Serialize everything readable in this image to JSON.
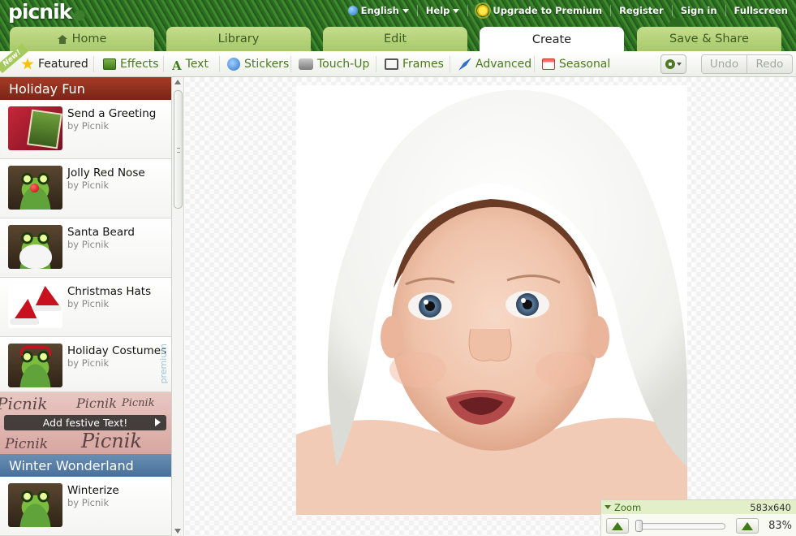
{
  "app": {
    "logo": "picnik"
  },
  "toplinks": {
    "language": "English",
    "help": "Help",
    "upgrade": "Upgrade to Premium",
    "register": "Register",
    "signin": "Sign in",
    "fullscreen": "Fullscreen"
  },
  "tabs": [
    {
      "label": "Home"
    },
    {
      "label": "Library"
    },
    {
      "label": "Edit"
    },
    {
      "label": "Create"
    },
    {
      "label": "Save & Share"
    }
  ],
  "toolbar": {
    "new_badge": "New!",
    "items": [
      {
        "label": "Featured"
      },
      {
        "label": "Effects"
      },
      {
        "label": "Text"
      },
      {
        "label": "Stickers"
      },
      {
        "label": "Touch-Up"
      },
      {
        "label": "Frames"
      },
      {
        "label": "Advanced"
      },
      {
        "label": "Seasonal"
      }
    ],
    "undo": "Undo",
    "redo": "Redo"
  },
  "sidebar": {
    "section1": "Holiday Fun",
    "items": [
      {
        "title": "Send a Greeting",
        "by": "by Picnik"
      },
      {
        "title": "Jolly Red Nose",
        "by": "by Picnik"
      },
      {
        "title": "Santa Beard",
        "by": "by Picnik"
      },
      {
        "title": "Christmas Hats",
        "by": "by Picnik"
      },
      {
        "title": "Holiday Costumes",
        "by": "by Picnik",
        "badge": "premium"
      }
    ],
    "promo": "Add festive Text!",
    "promo_words": [
      "Picnik",
      "Picnik",
      "Picnik",
      "Picnik",
      "Picnik"
    ],
    "section2": "Winter Wonderland",
    "items2": [
      {
        "title": "Winterize",
        "by": "by Picnik"
      }
    ]
  },
  "zoom": {
    "label": "Zoom",
    "dimensions": "583x640",
    "percent": "83%"
  },
  "colors": {
    "accent_green": "#4a7a1c",
    "holiday_header": "#a63a26",
    "winter_header": "#5b82aa"
  }
}
